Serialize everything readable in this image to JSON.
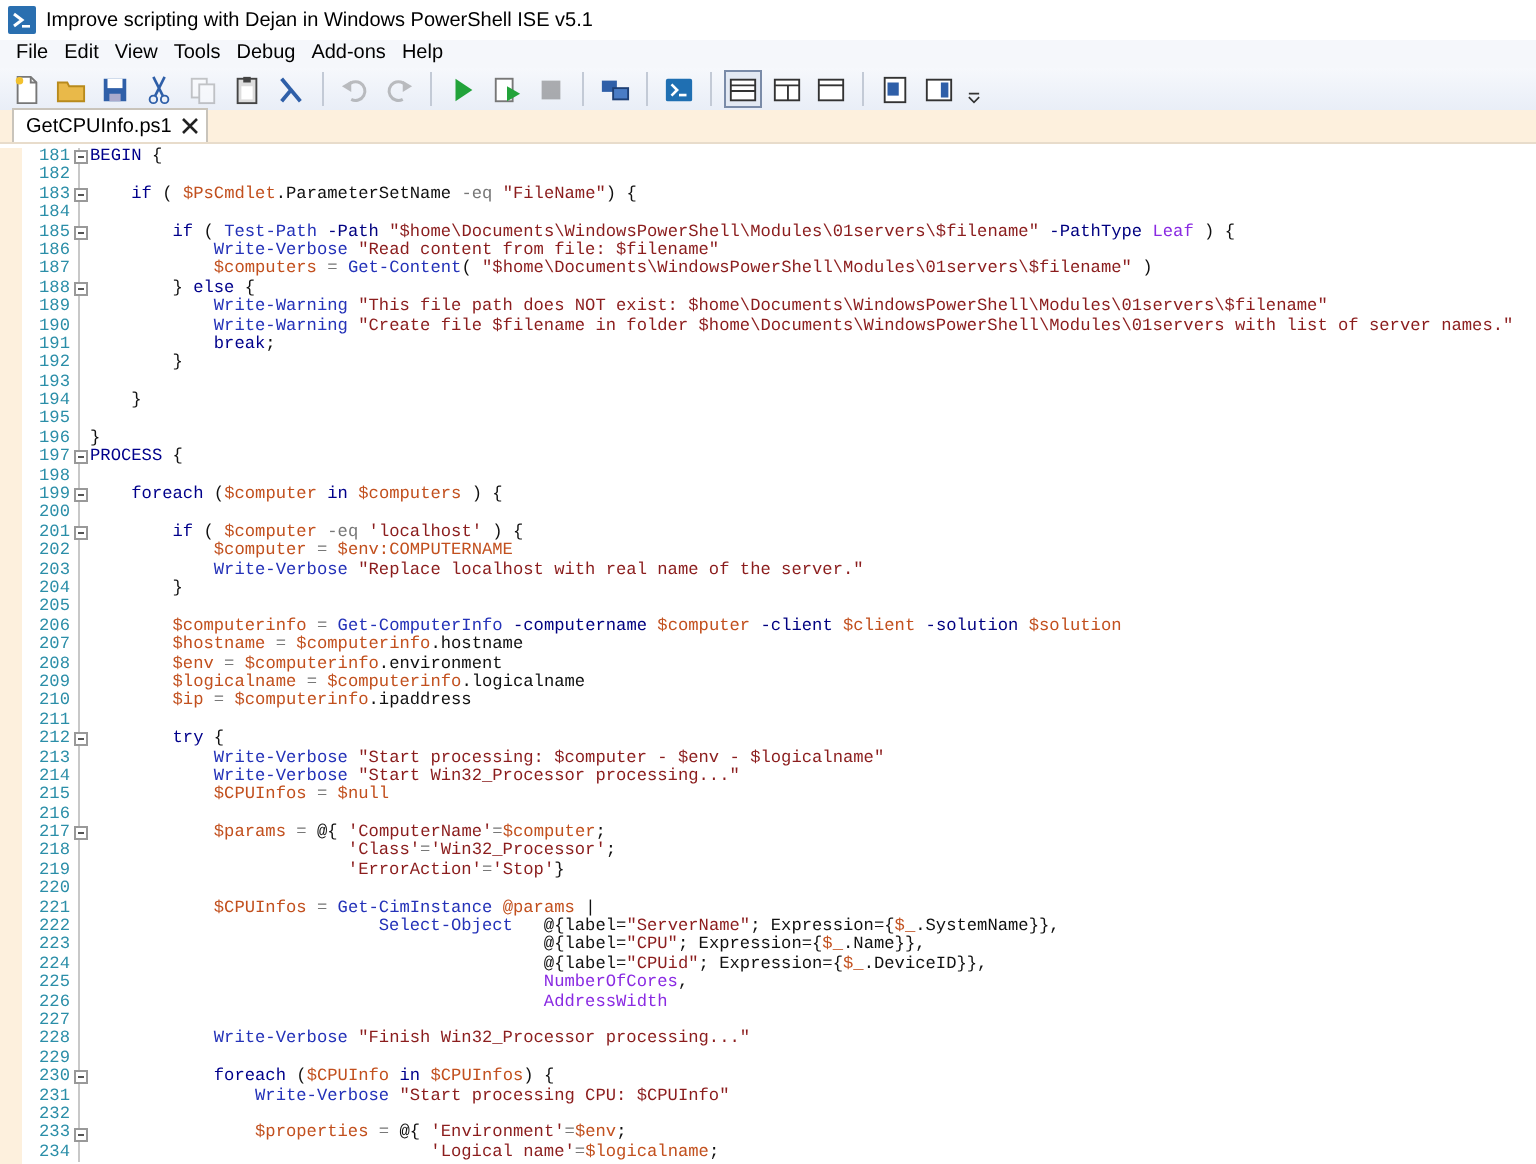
{
  "window": {
    "title": "Improve scripting with Dejan in Windows PowerShell ISE v5.1"
  },
  "menu": [
    "File",
    "Edit",
    "View",
    "Tools",
    "Debug",
    "Add-ons",
    "Help"
  ],
  "toolbar": [
    {
      "kind": "new",
      "disabled": false
    },
    {
      "kind": "open",
      "disabled": false
    },
    {
      "kind": "save",
      "disabled": false
    },
    {
      "kind": "cut",
      "disabled": false
    },
    {
      "kind": "copy",
      "disabled": true
    },
    {
      "kind": "paste",
      "disabled": false
    },
    {
      "kind": "clear",
      "disabled": false
    },
    {
      "kind": "separator"
    },
    {
      "kind": "undo",
      "disabled": true
    },
    {
      "kind": "redo",
      "disabled": true
    },
    {
      "kind": "separator"
    },
    {
      "kind": "run",
      "disabled": false
    },
    {
      "kind": "run-selection",
      "disabled": false
    },
    {
      "kind": "stop",
      "disabled": true
    },
    {
      "kind": "separator"
    },
    {
      "kind": "remote",
      "disabled": false
    },
    {
      "kind": "separator"
    },
    {
      "kind": "console",
      "disabled": false
    },
    {
      "kind": "separator"
    },
    {
      "kind": "layout-top",
      "disabled": false,
      "selected": true
    },
    {
      "kind": "layout-right",
      "disabled": false,
      "selected": false
    },
    {
      "kind": "layout-max",
      "disabled": false,
      "selected": false
    },
    {
      "kind": "separator"
    },
    {
      "kind": "script-pane",
      "disabled": false
    },
    {
      "kind": "command-addon",
      "disabled": false
    },
    {
      "kind": "overflow",
      "disabled": false
    }
  ],
  "tabs": [
    {
      "label": "GetCPUInfo.ps1",
      "selected": true
    }
  ],
  "editor": {
    "lines": [
      {
        "number": "181",
        "expanded": true,
        "tokens": [
          {
            "kind": "keyword",
            "text": "BEGIN"
          },
          {
            "kind": "plain",
            "text": " {"
          }
        ]
      },
      {
        "number": "182"
      },
      {
        "number": "183",
        "expanded": true,
        "tokens": [
          {
            "kind": "keyword",
            "text": "    if"
          },
          {
            "kind": "plain",
            "text": " ( "
          },
          {
            "kind": "variable",
            "text": "$PsCmdlet"
          },
          {
            "kind": "plain",
            "text": ".ParameterSetName "
          },
          {
            "kind": "operator",
            "text": "-eq "
          },
          {
            "kind": "string",
            "text": "\"FileName\""
          },
          {
            "kind": "plain",
            "text": ") {"
          }
        ]
      },
      {
        "number": "184"
      },
      {
        "number": "185",
        "expanded": true,
        "tokens": [
          {
            "kind": "keyword",
            "text": "        if"
          },
          {
            "kind": "plain",
            "text": " ( "
          },
          {
            "kind": "command",
            "text": "Test-Path "
          },
          {
            "kind": "parameter",
            "text": "-Path "
          },
          {
            "kind": "string",
            "text": "\"$home\\Documents\\WindowsPowerShell\\Modules\\01servers\\$filename\" "
          },
          {
            "kind": "parameter",
            "text": "-PathType "
          },
          {
            "kind": "argument",
            "text": "Leaf"
          },
          {
            "kind": "plain",
            "text": " ) {"
          }
        ]
      },
      {
        "number": "186",
        "tokens": [
          {
            "kind": "command",
            "text": "            Write-Verbose "
          },
          {
            "kind": "string",
            "text": "\"Read content from file: $filename\""
          }
        ]
      },
      {
        "number": "187",
        "tokens": [
          {
            "kind": "variable",
            "text": "            $computers "
          },
          {
            "kind": "operator",
            "text": "= "
          },
          {
            "kind": "command",
            "text": "Get-Content"
          },
          {
            "kind": "plain",
            "text": "( "
          },
          {
            "kind": "string",
            "text": "\"$home\\Documents\\WindowsPowerShell\\Modules\\01servers\\$filename\""
          },
          {
            "kind": "plain",
            "text": " )"
          }
        ]
      },
      {
        "number": "188",
        "expanded": true,
        "tokens": [
          {
            "kind": "plain",
            "text": "        } "
          },
          {
            "kind": "keyword",
            "text": "else"
          },
          {
            "kind": "plain",
            "text": " {"
          }
        ]
      },
      {
        "number": "189",
        "tokens": [
          {
            "kind": "command",
            "text": "            Write-Warning "
          },
          {
            "kind": "string",
            "text": "\"This file path does NOT exist: $home\\Documents\\WindowsPowerShell\\Modules\\01servers\\$filename\""
          }
        ]
      },
      {
        "number": "190",
        "tokens": [
          {
            "kind": "command",
            "text": "            Write-Warning "
          },
          {
            "kind": "string",
            "text": "\"Create file $filename in folder $home\\Documents\\WindowsPowerShell\\Modules\\01servers with list of server names.\""
          }
        ]
      },
      {
        "number": "191",
        "tokens": [
          {
            "kind": "keyword",
            "text": "            break"
          },
          {
            "kind": "plain",
            "text": ";"
          }
        ]
      },
      {
        "number": "192",
        "tokens": [
          {
            "kind": "plain",
            "text": "        }"
          }
        ]
      },
      {
        "number": "193"
      },
      {
        "number": "194",
        "tokens": [
          {
            "kind": "plain",
            "text": "    }"
          }
        ]
      },
      {
        "number": "195"
      },
      {
        "number": "196",
        "tokens": [
          {
            "kind": "plain",
            "text": "}"
          }
        ]
      },
      {
        "number": "197",
        "expanded": true,
        "tokens": [
          {
            "kind": "keyword",
            "text": "PROCESS"
          },
          {
            "kind": "plain",
            "text": " {"
          }
        ]
      },
      {
        "number": "198"
      },
      {
        "number": "199",
        "expanded": true,
        "tokens": [
          {
            "kind": "keyword",
            "text": "    foreach"
          },
          {
            "kind": "plain",
            "text": " ("
          },
          {
            "kind": "variable",
            "text": "$computer "
          },
          {
            "kind": "keyword",
            "text": "in "
          },
          {
            "kind": "variable",
            "text": "$computers"
          },
          {
            "kind": "plain",
            "text": " ) {"
          }
        ]
      },
      {
        "number": "200"
      },
      {
        "number": "201",
        "expanded": true,
        "tokens": [
          {
            "kind": "keyword",
            "text": "        if"
          },
          {
            "kind": "plain",
            "text": " ( "
          },
          {
            "kind": "variable",
            "text": "$computer "
          },
          {
            "kind": "operator",
            "text": "-eq "
          },
          {
            "kind": "string",
            "text": "'localhost'"
          },
          {
            "kind": "plain",
            "text": " ) {"
          }
        ]
      },
      {
        "number": "202",
        "tokens": [
          {
            "kind": "variable",
            "text": "            $computer "
          },
          {
            "kind": "operator",
            "text": "= "
          },
          {
            "kind": "variable",
            "text": "$env:COMPUTERNAME"
          }
        ]
      },
      {
        "number": "203",
        "tokens": [
          {
            "kind": "command",
            "text": "            Write-Verbose "
          },
          {
            "kind": "string",
            "text": "\"Replace localhost with real name of the server.\""
          }
        ]
      },
      {
        "number": "204",
        "tokens": [
          {
            "kind": "plain",
            "text": "        }"
          }
        ]
      },
      {
        "number": "205"
      },
      {
        "number": "206",
        "tokens": [
          {
            "kind": "variable",
            "text": "        $computerinfo "
          },
          {
            "kind": "operator",
            "text": "= "
          },
          {
            "kind": "command",
            "text": "Get-ComputerInfo "
          },
          {
            "kind": "parameter",
            "text": "-computername "
          },
          {
            "kind": "variable",
            "text": "$computer "
          },
          {
            "kind": "parameter",
            "text": "-client "
          },
          {
            "kind": "variable",
            "text": "$client "
          },
          {
            "kind": "parameter",
            "text": "-solution "
          },
          {
            "kind": "variable",
            "text": "$solution"
          }
        ]
      },
      {
        "number": "207",
        "tokens": [
          {
            "kind": "variable",
            "text": "        $hostname "
          },
          {
            "kind": "operator",
            "text": "= "
          },
          {
            "kind": "variable",
            "text": "$computerinfo"
          },
          {
            "kind": "plain",
            "text": ".hostname"
          }
        ]
      },
      {
        "number": "208",
        "tokens": [
          {
            "kind": "variable",
            "text": "        $env "
          },
          {
            "kind": "operator",
            "text": "= "
          },
          {
            "kind": "variable",
            "text": "$computerinfo"
          },
          {
            "kind": "plain",
            "text": ".environment"
          }
        ]
      },
      {
        "number": "209",
        "tokens": [
          {
            "kind": "variable",
            "text": "        $logicalname "
          },
          {
            "kind": "operator",
            "text": "= "
          },
          {
            "kind": "variable",
            "text": "$computerinfo"
          },
          {
            "kind": "plain",
            "text": ".logicalname"
          }
        ]
      },
      {
        "number": "210",
        "tokens": [
          {
            "kind": "variable",
            "text": "        $ip "
          },
          {
            "kind": "operator",
            "text": "= "
          },
          {
            "kind": "variable",
            "text": "$computerinfo"
          },
          {
            "kind": "plain",
            "text": ".ipaddress"
          }
        ]
      },
      {
        "number": "211"
      },
      {
        "number": "212",
        "expanded": true,
        "tokens": [
          {
            "kind": "keyword",
            "text": "        try"
          },
          {
            "kind": "plain",
            "text": " {"
          }
        ]
      },
      {
        "number": "213",
        "tokens": [
          {
            "kind": "command",
            "text": "            Write-Verbose "
          },
          {
            "kind": "string",
            "text": "\"Start processing: $computer - $env - $logicalname\""
          }
        ]
      },
      {
        "number": "214",
        "tokens": [
          {
            "kind": "command",
            "text": "            Write-Verbose "
          },
          {
            "kind": "string",
            "text": "\"Start Win32_Processor processing...\""
          }
        ]
      },
      {
        "number": "215",
        "tokens": [
          {
            "kind": "variable",
            "text": "            $CPUInfos "
          },
          {
            "kind": "operator",
            "text": "= "
          },
          {
            "kind": "variable",
            "text": "$null"
          }
        ]
      },
      {
        "number": "216"
      },
      {
        "number": "217",
        "expanded": true,
        "tokens": [
          {
            "kind": "variable",
            "text": "            $params "
          },
          {
            "kind": "operator",
            "text": "="
          },
          {
            "kind": "plain",
            "text": " @{ "
          },
          {
            "kind": "string",
            "text": "'ComputerName'"
          },
          {
            "kind": "operator",
            "text": "="
          },
          {
            "kind": "variable",
            "text": "$computer"
          },
          {
            "kind": "plain",
            "text": ";"
          }
        ]
      },
      {
        "number": "218",
        "tokens": [
          {
            "kind": "string",
            "text": "                         'Class'"
          },
          {
            "kind": "operator",
            "text": "="
          },
          {
            "kind": "string",
            "text": "'Win32_Processor'"
          },
          {
            "kind": "plain",
            "text": ";"
          }
        ]
      },
      {
        "number": "219",
        "tokens": [
          {
            "kind": "string",
            "text": "                         'ErrorAction'"
          },
          {
            "kind": "operator",
            "text": "="
          },
          {
            "kind": "string",
            "text": "'Stop'"
          },
          {
            "kind": "plain",
            "text": "}"
          }
        ]
      },
      {
        "number": "220"
      },
      {
        "number": "221",
        "tokens": [
          {
            "kind": "variable",
            "text": "            $CPUInfos "
          },
          {
            "kind": "operator",
            "text": "= "
          },
          {
            "kind": "command",
            "text": "Get-CimInstance "
          },
          {
            "kind": "variable",
            "text": "@params"
          },
          {
            "kind": "plain",
            "text": " |"
          }
        ]
      },
      {
        "number": "222",
        "tokens": [
          {
            "kind": "command",
            "text": "                            Select-Object"
          },
          {
            "kind": "plain",
            "text": "   @{label="
          },
          {
            "kind": "string",
            "text": "\"ServerName\""
          },
          {
            "kind": "plain",
            "text": "; Expression={"
          },
          {
            "kind": "variable",
            "text": "$_"
          },
          {
            "kind": "plain",
            "text": ".SystemName}},"
          }
        ]
      },
      {
        "number": "223",
        "tokens": [
          {
            "kind": "plain",
            "text": "                                            @{label="
          },
          {
            "kind": "string",
            "text": "\"CPU\""
          },
          {
            "kind": "plain",
            "text": "; Expression={"
          },
          {
            "kind": "variable",
            "text": "$_"
          },
          {
            "kind": "plain",
            "text": ".Name}},"
          }
        ]
      },
      {
        "number": "224",
        "tokens": [
          {
            "kind": "plain",
            "text": "                                            @{label="
          },
          {
            "kind": "string",
            "text": "\"CPUid\""
          },
          {
            "kind": "plain",
            "text": "; Expression={"
          },
          {
            "kind": "variable",
            "text": "$_"
          },
          {
            "kind": "plain",
            "text": ".DeviceID}},"
          }
        ]
      },
      {
        "number": "225",
        "tokens": [
          {
            "kind": "argument",
            "text": "                                            NumberOfCores"
          },
          {
            "kind": "plain",
            "text": ","
          }
        ]
      },
      {
        "number": "226",
        "tokens": [
          {
            "kind": "argument",
            "text": "                                            AddressWidth"
          }
        ]
      },
      {
        "number": "227"
      },
      {
        "number": "228",
        "tokens": [
          {
            "kind": "command",
            "text": "            Write-Verbose "
          },
          {
            "kind": "string",
            "text": "\"Finish Win32_Processor processing...\""
          }
        ]
      },
      {
        "number": "229"
      },
      {
        "number": "230",
        "expanded": true,
        "tokens": [
          {
            "kind": "keyword",
            "text": "            foreach"
          },
          {
            "kind": "plain",
            "text": " ("
          },
          {
            "kind": "variable",
            "text": "$CPUInfo "
          },
          {
            "kind": "keyword",
            "text": "in "
          },
          {
            "kind": "variable",
            "text": "$CPUInfos"
          },
          {
            "kind": "plain",
            "text": ") {"
          }
        ]
      },
      {
        "number": "231",
        "tokens": [
          {
            "kind": "command",
            "text": "                Write-Verbose "
          },
          {
            "kind": "string",
            "text": "\"Start processing CPU: $CPUInfo\""
          }
        ]
      },
      {
        "number": "232"
      },
      {
        "number": "233",
        "expanded": true,
        "tokens": [
          {
            "kind": "variable",
            "text": "                $properties "
          },
          {
            "kind": "operator",
            "text": "="
          },
          {
            "kind": "plain",
            "text": " @{ "
          },
          {
            "kind": "string",
            "text": "'Environment'"
          },
          {
            "kind": "operator",
            "text": "="
          },
          {
            "kind": "variable",
            "text": "$env"
          },
          {
            "kind": "plain",
            "text": ";"
          }
        ]
      },
      {
        "number": "234",
        "tokens": [
          {
            "kind": "string",
            "text": "                                 'Logical name'"
          },
          {
            "kind": "operator",
            "text": "="
          },
          {
            "kind": "variable",
            "text": "$logicalname"
          },
          {
            "kind": "plain",
            "text": ";"
          }
        ]
      }
    ]
  }
}
